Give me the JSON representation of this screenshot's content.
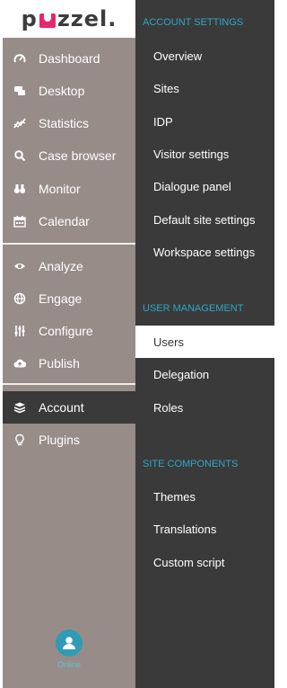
{
  "brand": {
    "logo_left": "p",
    "logo_right": "zzel.",
    "accent": "#e8266d"
  },
  "sidebar": {
    "background": "#978c88",
    "active_background": "#3a3a3a",
    "items": [
      {
        "label": "Dashboard",
        "icon": "speedometer-icon"
      },
      {
        "label": "Desktop",
        "icon": "chat-bubble-icon"
      },
      {
        "label": "Statistics",
        "icon": "line-chart-icon"
      },
      {
        "label": "Case browser",
        "icon": "search-icon"
      },
      {
        "label": "Monitor",
        "icon": "binoculars-icon"
      },
      {
        "label": "Calendar",
        "icon": "calendar-icon"
      },
      {
        "label": "Analyze",
        "icon": "eye-icon"
      },
      {
        "label": "Engage",
        "icon": "globe-icon"
      },
      {
        "label": "Configure",
        "icon": "sliders-icon"
      },
      {
        "label": "Publish",
        "icon": "cloud-upload-icon"
      },
      {
        "label": "Account",
        "icon": "layers-icon",
        "active": true
      },
      {
        "label": "Plugins",
        "icon": "lightbulb-icon"
      }
    ],
    "user": {
      "status": "Online",
      "icon": "user-icon"
    }
  },
  "submenu": {
    "background": "#3a3a3a",
    "heading_color": "#2ea7c6",
    "sections": [
      {
        "title": "Account settings",
        "items": [
          "Overview",
          "Sites",
          "IDP",
          "Visitor settings",
          "Dialogue panel",
          "Default site settings",
          "Workspace settings"
        ]
      },
      {
        "title": "User management",
        "items": [
          "Users",
          "Delegation",
          "Roles"
        ],
        "active": "Users"
      },
      {
        "title": "Site components",
        "items": [
          "Themes",
          "Translations",
          "Custom script"
        ]
      }
    ]
  }
}
